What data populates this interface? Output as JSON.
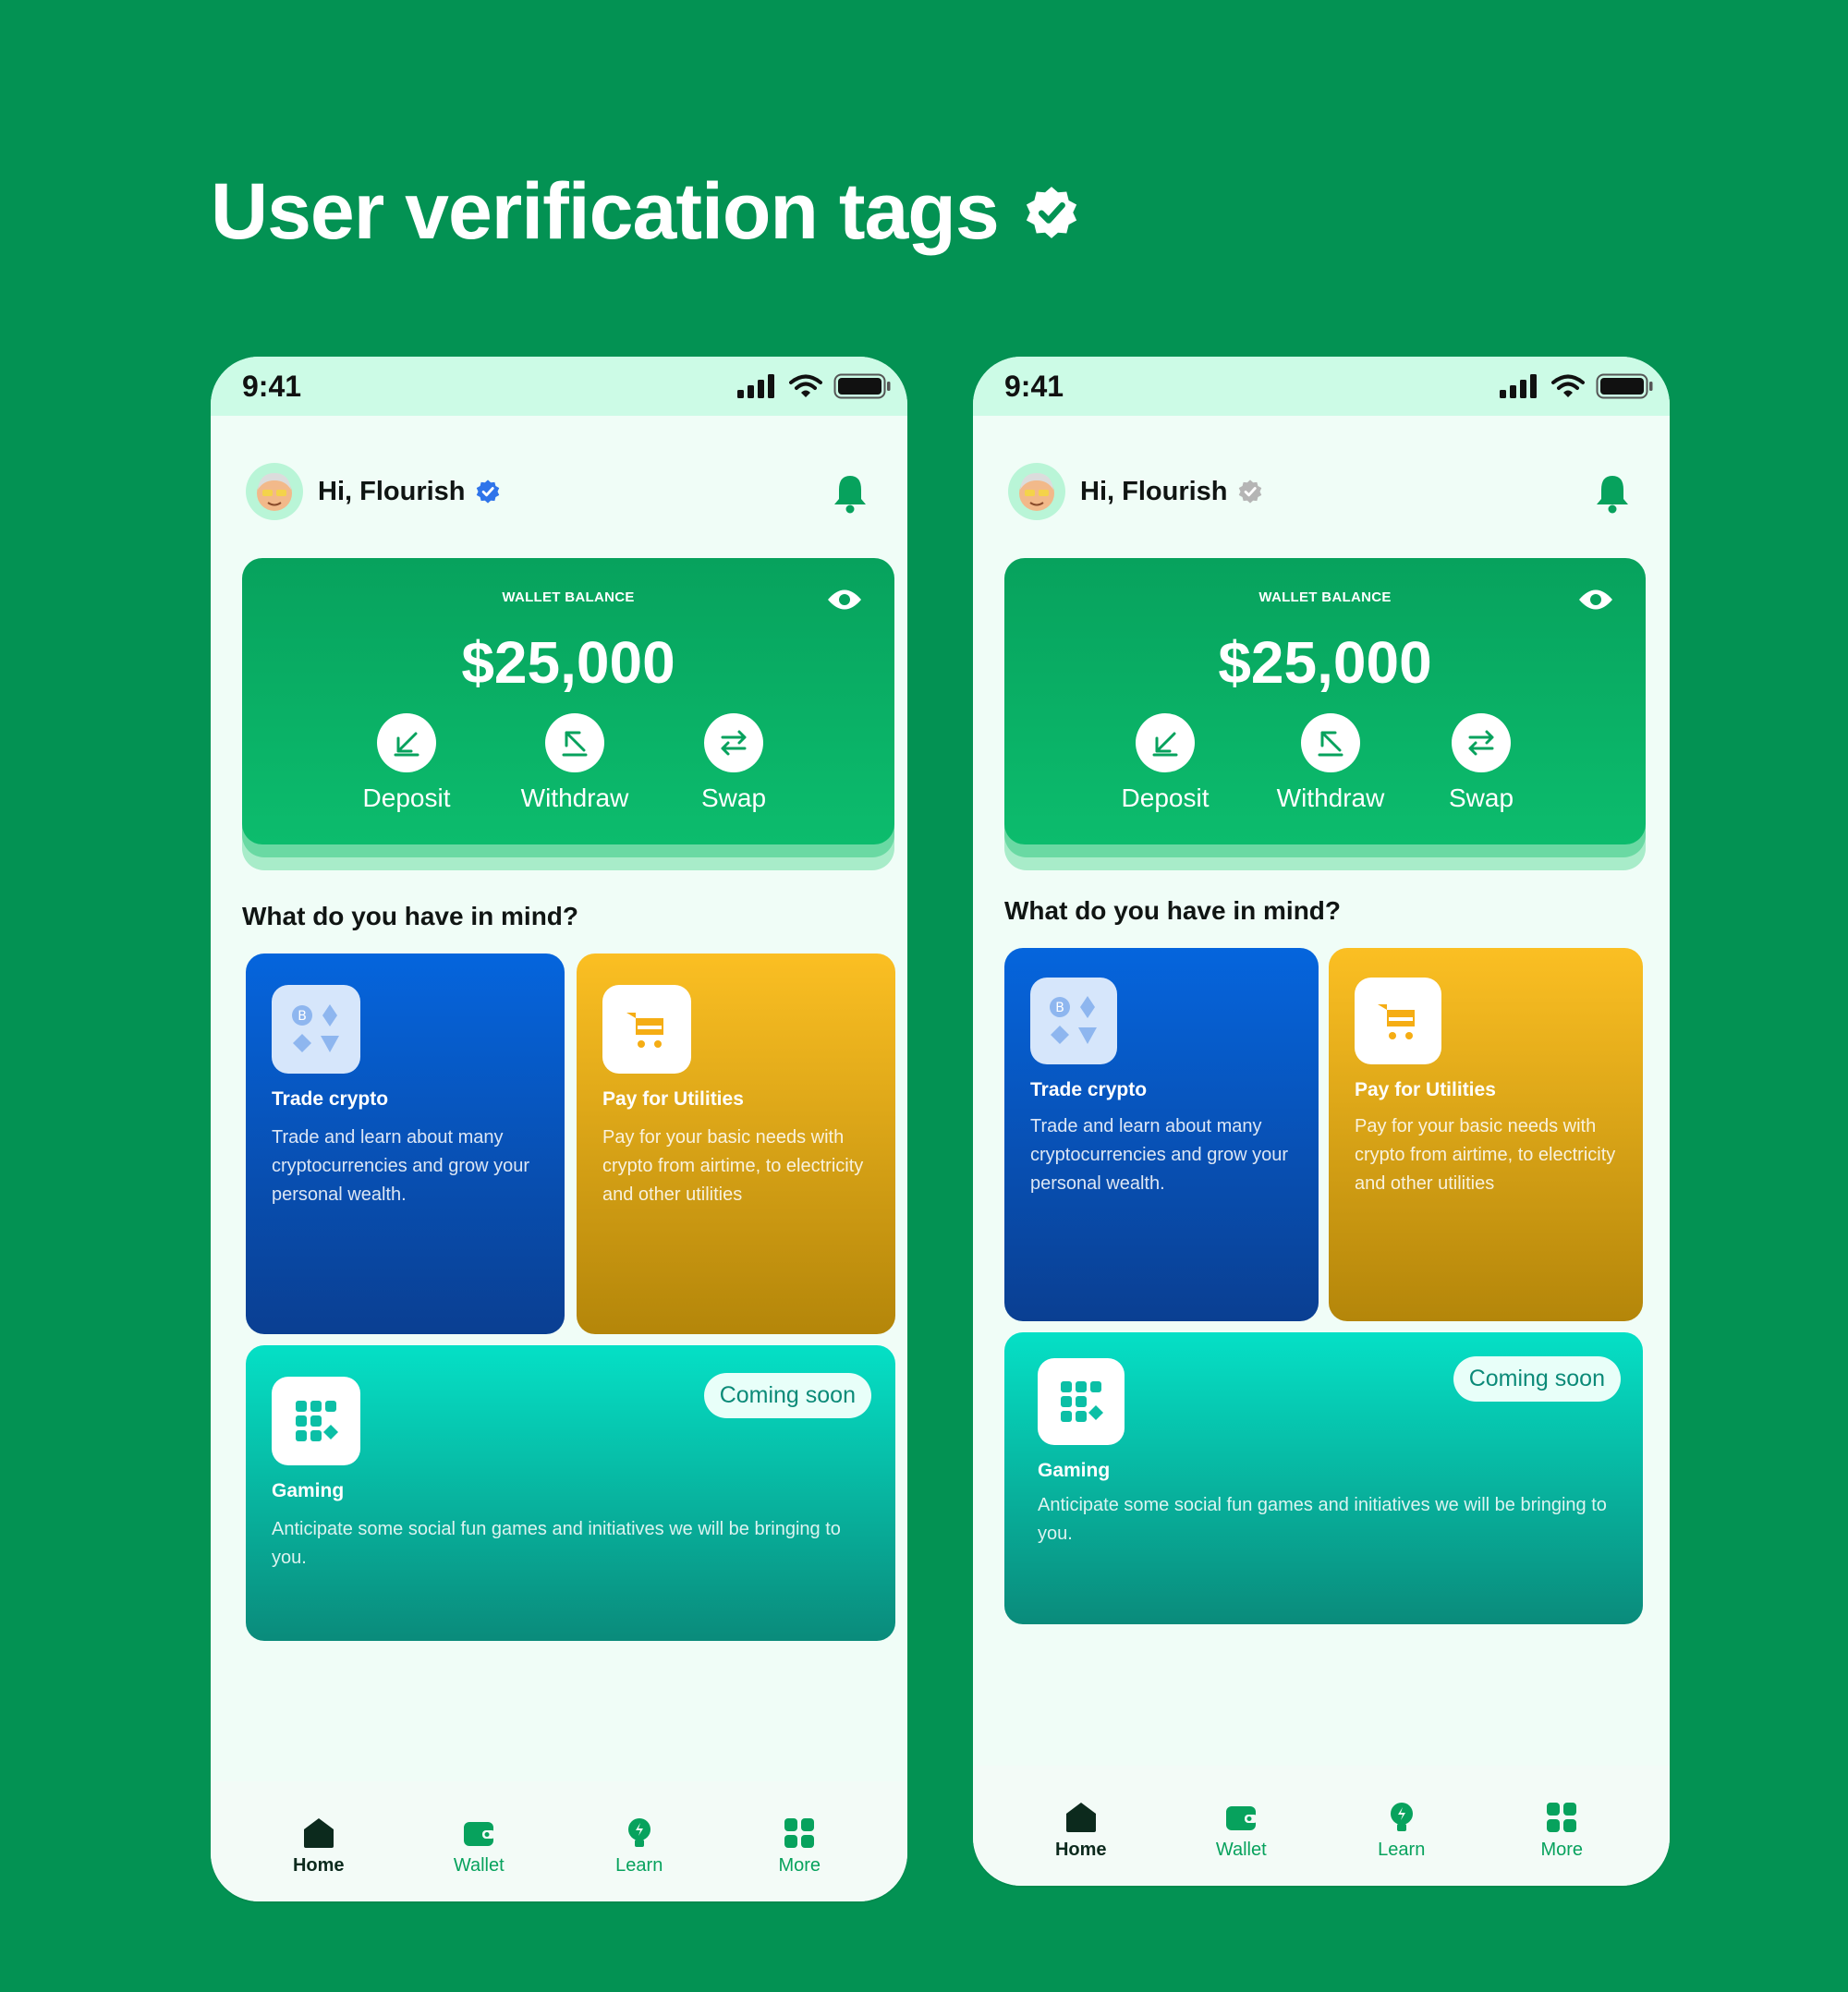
{
  "page": {
    "title": "User verification tags"
  },
  "colors": {
    "background": "#039253",
    "verified_badge": "#2f74ea",
    "unverified_badge": "#b5b5b5",
    "brand_green": "#07a25d"
  },
  "phones": [
    {
      "status": {
        "time": "9:41"
      },
      "greeting": "Hi, Flourish",
      "badge_state": "verified",
      "wallet": {
        "label": "WALLET BALANCE",
        "amount": "$25,000"
      },
      "actions": [
        {
          "label": "Deposit"
        },
        {
          "label": "Withdraw"
        },
        {
          "label": "Swap"
        }
      ],
      "section_title": "What do you have in mind?",
      "tiles": {
        "crypto": {
          "title": "Trade crypto",
          "desc": "Trade and learn about many cryptocurrencies and grow your personal wealth."
        },
        "utilities": {
          "title": "Pay for Utilities",
          "desc": "Pay for your basic needs with crypto from airtime, to electricity and other utilities"
        },
        "gaming": {
          "title": "Gaming",
          "desc": "Anticipate some social fun games and initiatives we will be bringing to you.",
          "badge": "Coming soon"
        }
      },
      "nav": [
        {
          "label": "Home",
          "icon": "home-icon"
        },
        {
          "label": "Wallet",
          "icon": "wallet-icon"
        },
        {
          "label": "Learn",
          "icon": "learn-icon"
        },
        {
          "label": "More",
          "icon": "grid-icon"
        }
      ]
    },
    {
      "status": {
        "time": "9:41"
      },
      "greeting": "Hi, Flourish",
      "badge_state": "unverified",
      "wallet": {
        "label": "WALLET BALANCE",
        "amount": "$25,000"
      },
      "actions": [
        {
          "label": "Deposit"
        },
        {
          "label": "Withdraw"
        },
        {
          "label": "Swap"
        }
      ],
      "section_title": "What do you have in mind?",
      "tiles": {
        "crypto": {
          "title": "Trade crypto",
          "desc": "Trade and learn about many cryptocurrencies and grow your personal wealth."
        },
        "utilities": {
          "title": "Pay for Utilities",
          "desc": "Pay for your basic needs with crypto from airtime, to electricity and other utilities"
        },
        "gaming": {
          "title": "Gaming",
          "desc": "Anticipate some social fun games and initiatives we will be bringing to you.",
          "badge": "Coming soon"
        }
      },
      "nav": [
        {
          "label": "Home",
          "icon": "home-icon"
        },
        {
          "label": "Wallet",
          "icon": "wallet-icon"
        },
        {
          "label": "Learn",
          "icon": "learn-icon"
        },
        {
          "label": "More",
          "icon": "grid-icon"
        }
      ]
    }
  ]
}
